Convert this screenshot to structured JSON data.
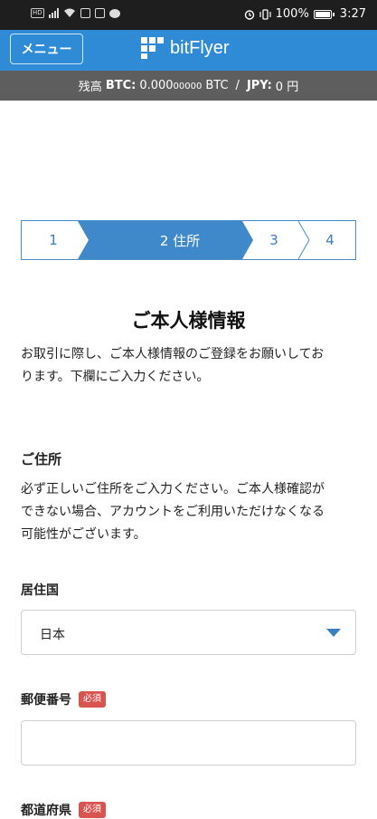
{
  "status_bar": {
    "hd_label": "HD",
    "battery_text": "100%",
    "time": "3:27"
  },
  "header": {
    "menu_label": "メニュー",
    "logo_text": "bitFlyer",
    "brand_color": "#2f8bd5"
  },
  "balance": {
    "prefix": "残高",
    "btc_label": "BTC:",
    "btc_main": "0.000",
    "btc_small": "00000",
    "btc_unit": "BTC",
    "separator": "/",
    "jpy_label": "JPY:",
    "jpy_value": "0 円"
  },
  "stepper": {
    "steps": [
      {
        "label": "1",
        "active": false
      },
      {
        "label": "2 住所",
        "active": true
      },
      {
        "label": "3",
        "active": false
      },
      {
        "label": "4",
        "active": false
      }
    ],
    "accent": "#4a8dc9"
  },
  "main": {
    "title": "ご本人様情報",
    "intro_line1": "お取引に際し、ご本人様情報のご登録をお願いしてお",
    "intro_line2": "ります。下欄にご入力ください。",
    "address_heading": "ご住所",
    "address_note_line1": "必ず正しいご住所をご入力ください。ご本人様確認が",
    "address_note_line2": "できない場合、アカウントをご利用いただけなくなる",
    "address_note_line3": "可能性がございます。",
    "country_label": "居住国",
    "country_value": "日本",
    "postal_label": "郵便番号",
    "postal_required": "必須",
    "postal_value": "",
    "prefecture_label": "都道府県",
    "prefecture_required": "必須"
  }
}
